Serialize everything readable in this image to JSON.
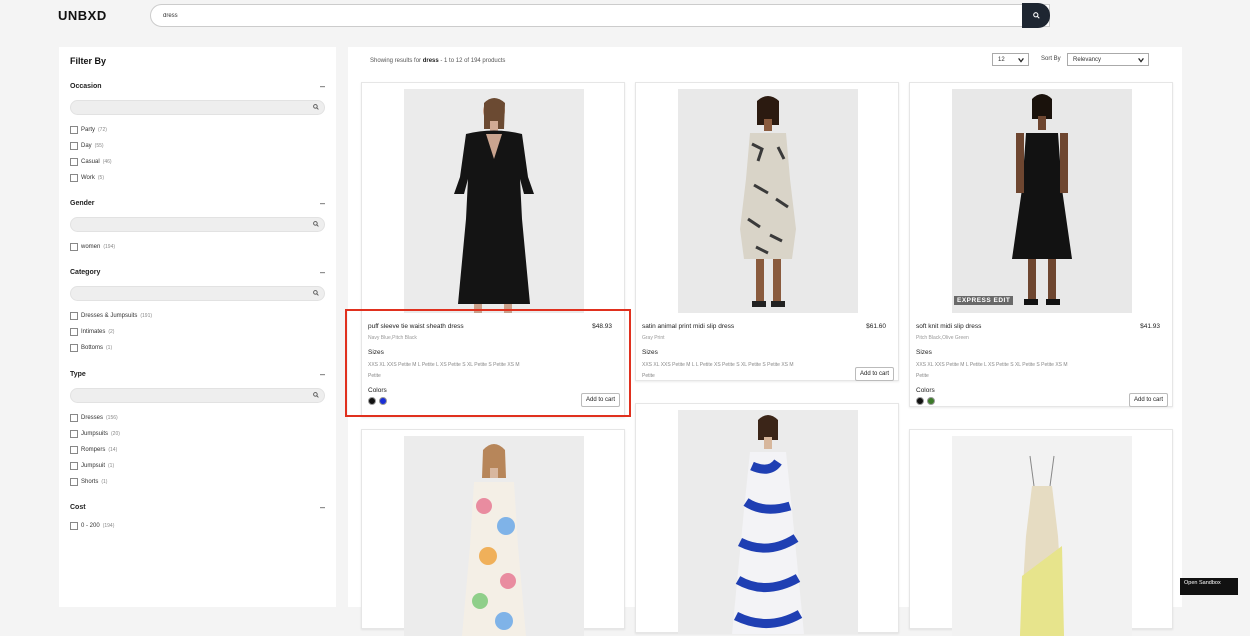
{
  "brand": {
    "logo": "UNBXD"
  },
  "search": {
    "value": "dress",
    "button_icon": "search-icon"
  },
  "sidebar": {
    "title": "Filter By",
    "facets": [
      {
        "name": "Occasion",
        "options": [
          {
            "label": "Party",
            "count": "(72)"
          },
          {
            "label": "Day",
            "count": "(55)"
          },
          {
            "label": "Casual",
            "count": "(46)"
          },
          {
            "label": "Work",
            "count": "(5)"
          }
        ]
      },
      {
        "name": "Gender",
        "options": [
          {
            "label": "women",
            "count": "(194)"
          }
        ]
      },
      {
        "name": "Category",
        "options": [
          {
            "label": "Dresses & Jumpsuits",
            "count": "(191)"
          },
          {
            "label": "Intimates",
            "count": "(2)"
          },
          {
            "label": "Bottoms",
            "count": "(1)"
          }
        ]
      },
      {
        "name": "Type",
        "options": [
          {
            "label": "Dresses",
            "count": "(156)"
          },
          {
            "label": "Jumpsuits",
            "count": "(20)"
          },
          {
            "label": "Rompers",
            "count": "(14)"
          },
          {
            "label": "Jumpsuit",
            "count": "(1)"
          },
          {
            "label": "Shorts",
            "count": "(1)"
          }
        ]
      },
      {
        "name": "Cost",
        "options": [
          {
            "label": "0 - 200",
            "count": "(194)"
          }
        ]
      }
    ],
    "collapse_symbol": "–"
  },
  "results": {
    "prefix": "Showing results for",
    "query": "dress",
    "suffix": "- 1 to 12 of 194 products",
    "per_page": "12",
    "sort_label": "Sort By",
    "sort_value": "Relevancy"
  },
  "products": [
    {
      "name": "puff sleeve tie waist sheath dress",
      "price": "$48.93",
      "color_names": "Navy Blue,Pitch Black",
      "sizes_label": "Sizes",
      "sizes": "XXS  XL  XXS Petite  M  L Petite  L  XS Petite  S  XL Petite  S Petite  XS  M Petite",
      "colors_label": "Colors",
      "swatches": [
        "#111111",
        "#1a2fd6"
      ],
      "add_label": "Add to cart"
    },
    {
      "name": "satin animal print midi slip dress",
      "price": "$61.60",
      "color_names": "Gray Print",
      "sizes_label": "Sizes",
      "sizes": "XXS  XL  XXS Petite  M  L  L Petite  XS Petite  S  XL Petite  S Petite  XS  M Petite",
      "colors_label": "",
      "swatches": [],
      "add_label": "Add to cart"
    },
    {
      "name": "soft knit midi slip dress",
      "price": "$41.93",
      "color_names": "Pitch Black,Olive Green",
      "sizes_label": "Sizes",
      "sizes": "XXS  XL  XXS Petite  M  L Petite  L  XS Petite  S  XL Petite  S Petite  XS  M Petite",
      "colors_label": "Colors",
      "swatches": [
        "#111111",
        "#3d7a2a"
      ],
      "add_label": "Add to cart",
      "badge": "EXPRESS EDIT"
    }
  ],
  "sandbox": {
    "label": "Open Sandbox"
  }
}
